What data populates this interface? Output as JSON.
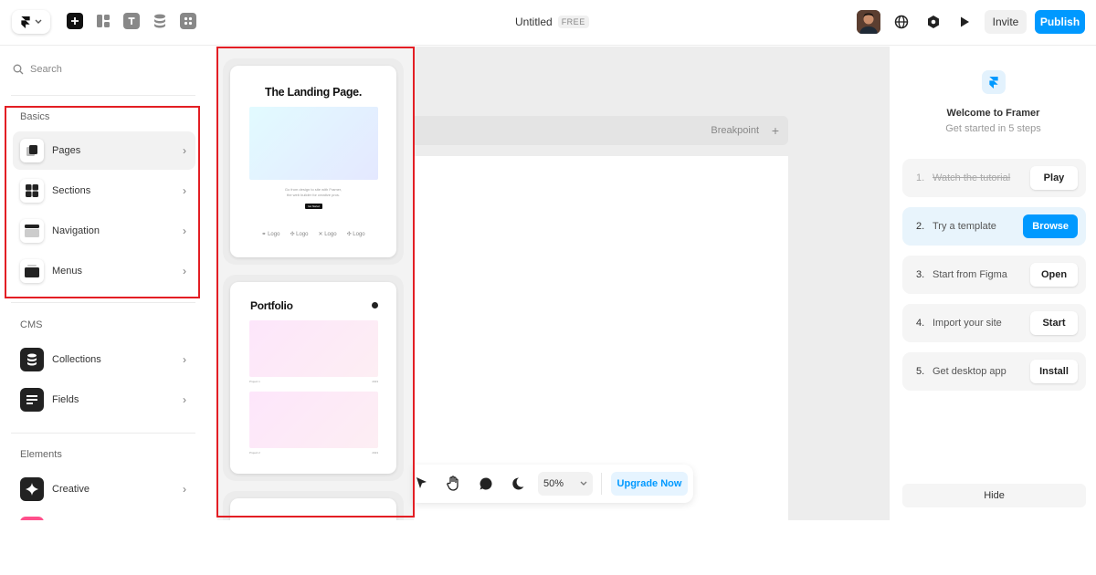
{
  "topbar": {
    "title": "Untitled",
    "plan_badge": "FREE",
    "invite_label": "Invite",
    "publish_label": "Publish",
    "tool_icons": [
      "insert-icon",
      "layout-icon",
      "text-icon",
      "cms-icon",
      "components-icon"
    ]
  },
  "sidebar": {
    "search_placeholder": "Search",
    "sections": [
      {
        "label": "Basics"
      },
      {
        "label": "CMS"
      },
      {
        "label": "Elements"
      }
    ],
    "basics_items": [
      {
        "label": "Pages"
      },
      {
        "label": "Sections"
      },
      {
        "label": "Navigation"
      },
      {
        "label": "Menus"
      }
    ],
    "cms_items": [
      {
        "label": "Collections"
      },
      {
        "label": "Fields"
      }
    ],
    "elements_items": [
      {
        "label": "Creative"
      }
    ]
  },
  "templates": {
    "landing": {
      "title": "The Landing Page.",
      "body_line1": "Go from design to site with Framer,",
      "body_line2": "the web builder for creative pros.",
      "button": "Get Started",
      "logos": [
        "Logo",
        "Logo",
        "Logo",
        "Logo"
      ]
    },
    "portfolio": {
      "title": "Portfolio",
      "project1": "Project 1",
      "project1_year": "2023",
      "project2": "Project 2",
      "project2_year": "2023"
    }
  },
  "canvas": {
    "breakpoint_label": "Breakpoint",
    "zoom": "50%",
    "upgrade_label": "Upgrade Now"
  },
  "welcome": {
    "title": "Welcome to Framer",
    "subtitle": "Get started in 5 steps",
    "steps": [
      {
        "num": "1.",
        "label": "Watch the tutorial",
        "button": "Play"
      },
      {
        "num": "2.",
        "label": "Try a template",
        "button": "Browse"
      },
      {
        "num": "3.",
        "label": "Start from Figma",
        "button": "Open"
      },
      {
        "num": "4.",
        "label": "Import your site",
        "button": "Start"
      },
      {
        "num": "5.",
        "label": "Get desktop app",
        "button": "Install"
      }
    ],
    "hide_label": "Hide"
  },
  "colors": {
    "accent": "#0099ff",
    "highlight_box": "#e31e24"
  }
}
